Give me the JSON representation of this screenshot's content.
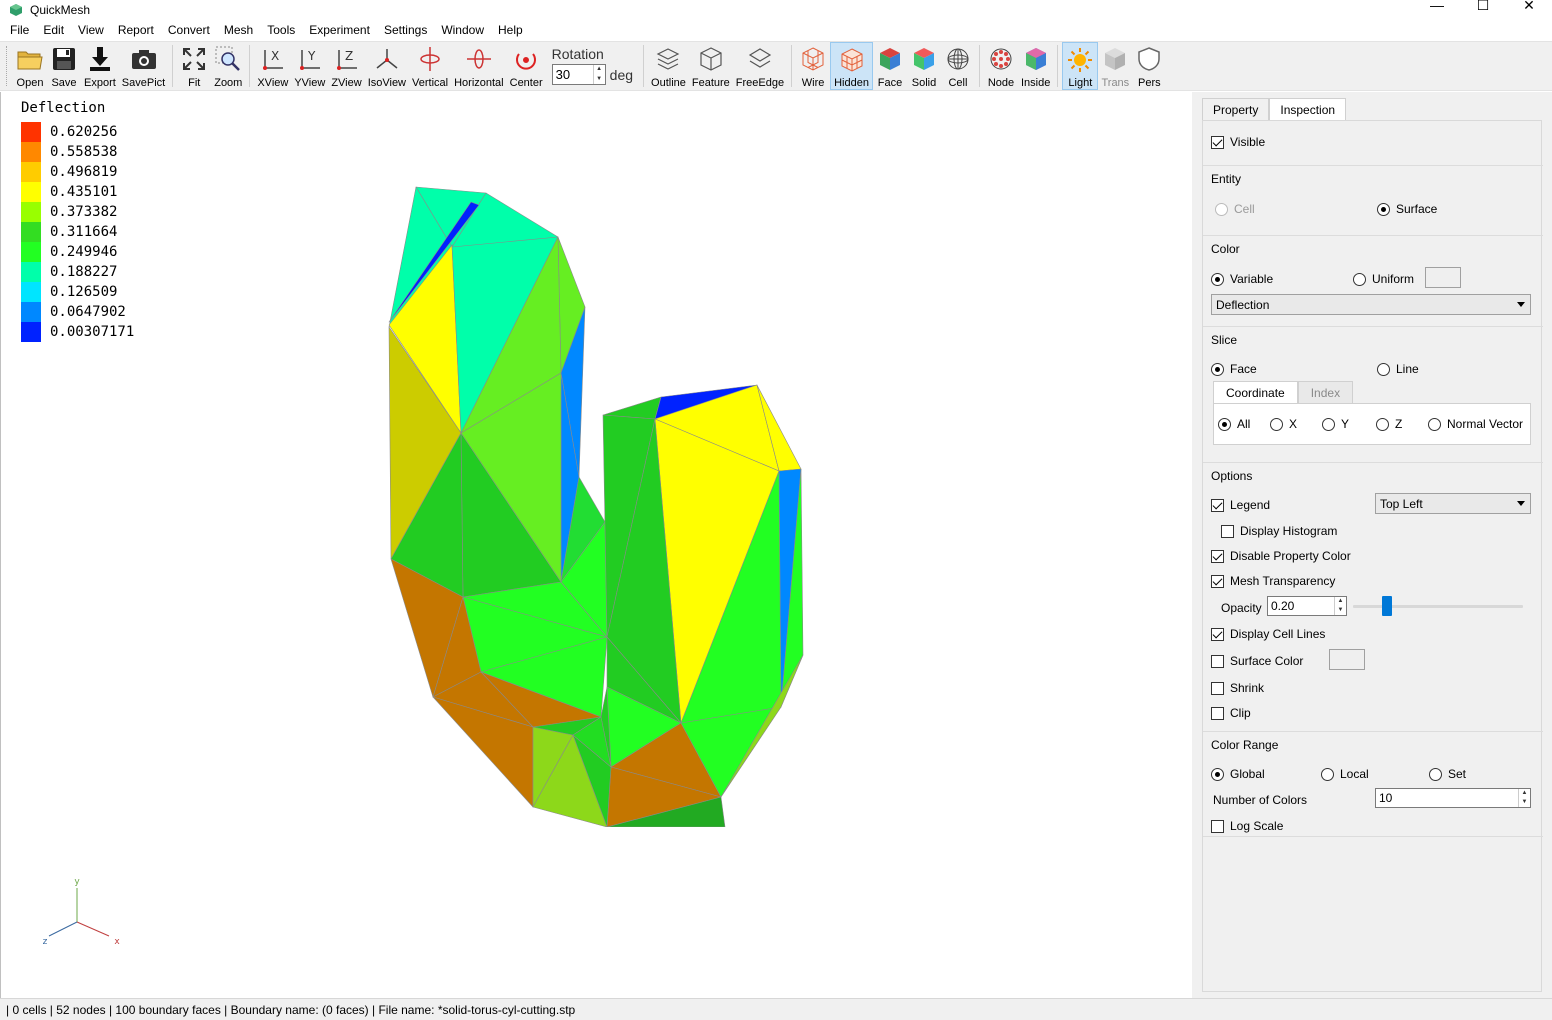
{
  "window": {
    "title": "QuickMesh",
    "minimize": "—",
    "maximize": "☐",
    "close": "✕"
  },
  "menu": [
    "File",
    "Edit",
    "View",
    "Report",
    "Convert",
    "Mesh",
    "Tools",
    "Experiment",
    "Settings",
    "Window",
    "Help"
  ],
  "toolbar": {
    "open": "Open",
    "save": "Save",
    "export": "Export",
    "savepict": "SavePict",
    "fit": "Fit",
    "zoom": "Zoom",
    "xview": "XView",
    "yview": "YView",
    "zview": "ZView",
    "isoview": "IsoView",
    "vertical": "Vertical",
    "horizontal": "Horizontal",
    "center": "Center",
    "rotation_title": "Rotation",
    "rotation_value": "30",
    "rotation_unit": "deg",
    "outline": "Outline",
    "feature": "Feature",
    "freeedge": "FreeEdge",
    "wire": "Wire",
    "hidden": "Hidden",
    "face": "Face",
    "solid": "Solid",
    "cell": "Cell",
    "node": "Node",
    "inside": "Inside",
    "light": "Light",
    "trans": "Trans",
    "pers": "Pers"
  },
  "legend": {
    "title": "Deflection",
    "entries": [
      {
        "value": "0.620256",
        "color": "#ff3300"
      },
      {
        "value": "0.558538",
        "color": "#ff8800"
      },
      {
        "value": "0.496819",
        "color": "#ffcc00"
      },
      {
        "value": "0.435101",
        "color": "#ffff00"
      },
      {
        "value": "0.373382",
        "color": "#99ff00"
      },
      {
        "value": "0.311664",
        "color": "#33dd22"
      },
      {
        "value": "0.249946",
        "color": "#22ff22"
      },
      {
        "value": "0.188227",
        "color": "#00ffaa"
      },
      {
        "value": "0.126509",
        "color": "#00e5ff"
      },
      {
        "value": "0.0647902",
        "color": "#0088ff"
      },
      {
        "value": "0.00307171",
        "color": "#0022ff"
      }
    ]
  },
  "axes": {
    "x": "x",
    "y": "y",
    "z": "z"
  },
  "panel": {
    "tabs": [
      "Property",
      "Inspection"
    ],
    "visible": "Visible",
    "entity_title": "Entity",
    "entity_cell": "Cell",
    "entity_surface": "Surface",
    "color_title": "Color",
    "color_variable": "Variable",
    "color_uniform": "Uniform",
    "color_select": "Deflection",
    "slice_title": "Slice",
    "slice_face": "Face",
    "slice_line": "Line",
    "slice_tabs": [
      "Coordinate",
      "Index"
    ],
    "coord_all": "All",
    "coord_x": "X",
    "coord_y": "Y",
    "coord_z": "Z",
    "coord_normal": "Normal Vector",
    "options_title": "Options",
    "legend": "Legend",
    "legend_pos": "Top Left",
    "display_histogram": "Display Histogram",
    "disable_property_color": "Disable Property Color",
    "mesh_transparency": "Mesh Transparency",
    "opacity_label": "Opacity",
    "opacity_value": "0.20",
    "opacity_level": 0.2,
    "display_cell_lines": "Display Cell Lines",
    "surface_color": "Surface Color",
    "shrink": "Shrink",
    "clip": "Clip",
    "range_title": "Color Range",
    "range_global": "Global",
    "range_local": "Local",
    "range_set": "Set",
    "num_colors_label": "Number of Colors",
    "num_colors_value": "10",
    "log_scale": "Log Scale"
  },
  "status": "| 0 cells | 52 nodes | 100 boundary faces |  Boundary name:  (0 faces) | File name: *solid-torus-cyl-cutting.stp"
}
